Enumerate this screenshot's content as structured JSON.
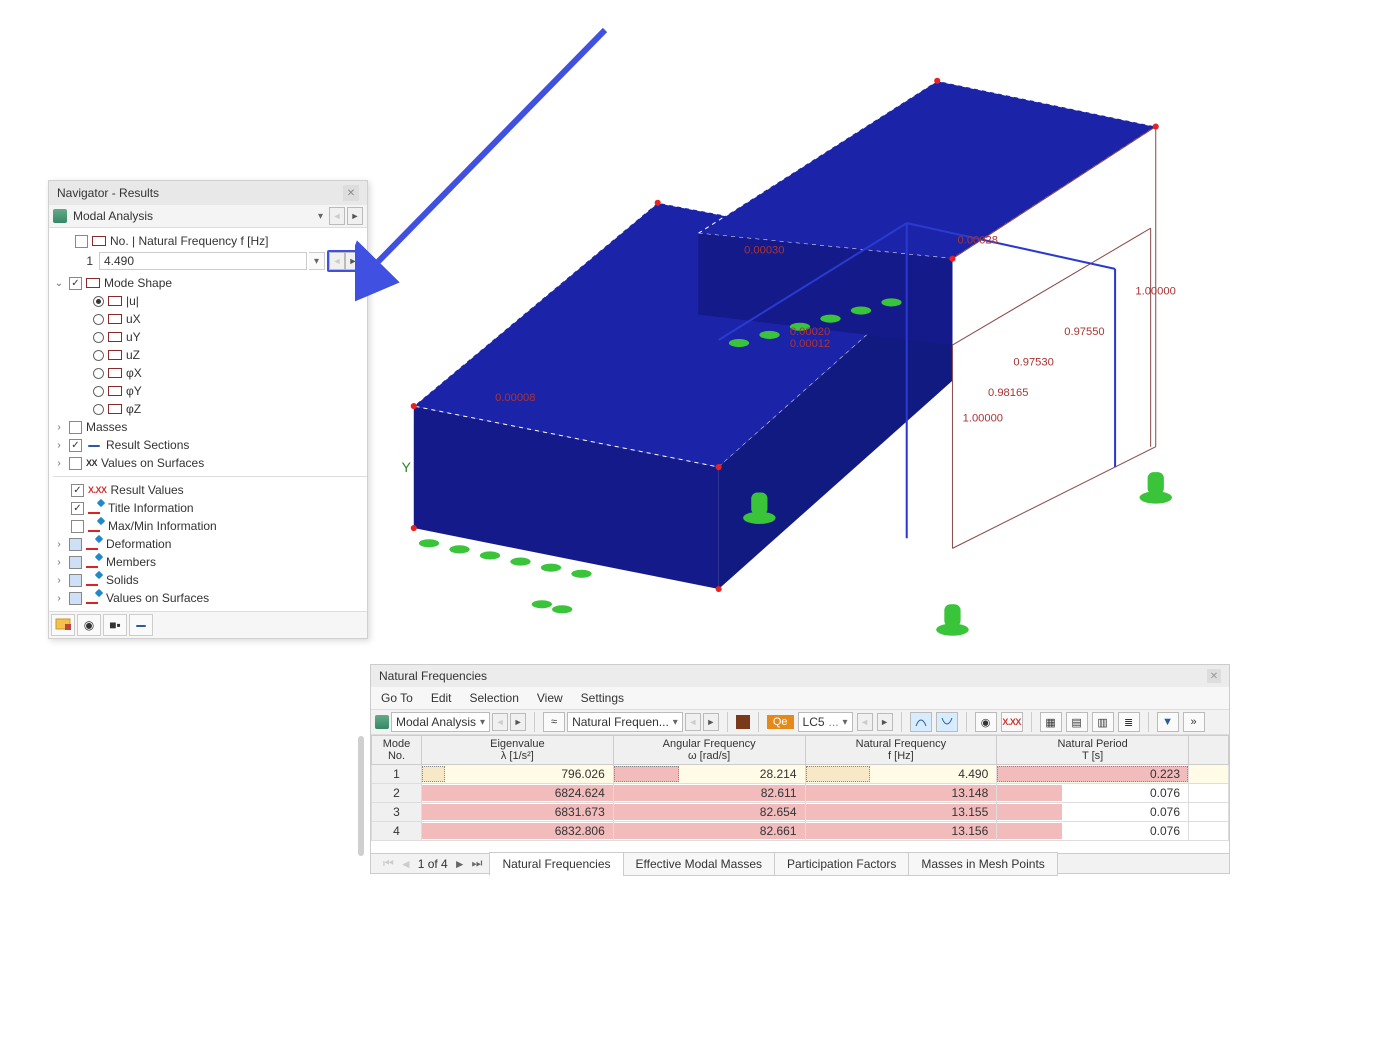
{
  "navigator": {
    "title": "Navigator - Results",
    "dropdown": "Modal Analysis",
    "mode_header": "No. | Natural Frequency f [Hz]",
    "mode_number": "1",
    "mode_value": "4.490",
    "mode_shape_label": "Mode Shape",
    "components": {
      "u": "|u|",
      "ux": "uX",
      "uy": "uY",
      "uz": "uZ",
      "px": "φX",
      "py": "φY",
      "pz": "φZ"
    },
    "masses": "Masses",
    "result_sections": "Result Sections",
    "values_on_surfaces_top": "Values on Surfaces",
    "result_values": "Result Values",
    "title_information": "Title Information",
    "maxmin_information": "Max/Min Information",
    "deformation": "Deformation",
    "members": "Members",
    "solids": "Solids",
    "values_on_surfaces_bottom": "Values on Surfaces"
  },
  "viewport": {
    "labels": {
      "top1": "0.00030",
      "top2": "0.00028",
      "leftmid": "0.00008",
      "mid1": "0.00020",
      "mid2": "0.00012",
      "right1": "1.00000",
      "right2": "0.97550",
      "right3": "0.97530",
      "right4": "0.98165",
      "right5": "1.00000",
      "axis_y": "Y"
    }
  },
  "results_panel": {
    "title": "Natural Frequencies",
    "menu": {
      "goto": "Go To",
      "edit": "Edit",
      "selection": "Selection",
      "view": "View",
      "settings": "Settings"
    },
    "toolbar": {
      "analysis_dd": "Modal Analysis",
      "result_dd": "Natural Frequen...",
      "qe": "Qe",
      "lc": "LC5",
      "lc_more": "..."
    },
    "columns": {
      "mode_no_l1": "Mode",
      "mode_no_l2": "No.",
      "eigen_l1": "Eigenvalue",
      "eigen_l2": "λ [1/s²]",
      "ang_l1": "Angular Frequency",
      "ang_l2": "ω [rad/s]",
      "nat_l1": "Natural Frequency",
      "nat_l2": "f [Hz]",
      "per_l1": "Natural Period",
      "per_l2": "T [s]"
    },
    "rows": [
      {
        "no": "1",
        "eigen": "796.026",
        "ang": "28.214",
        "nat": "4.490",
        "per": "0.223",
        "bars": {
          "eigen": 12,
          "ang": 34,
          "nat": 34,
          "per": 100
        },
        "sel": true
      },
      {
        "no": "2",
        "eigen": "6824.624",
        "ang": "82.611",
        "nat": "13.148",
        "per": "0.076",
        "bars": {
          "eigen": 100,
          "ang": 100,
          "nat": 100,
          "per": 34
        }
      },
      {
        "no": "3",
        "eigen": "6831.673",
        "ang": "82.654",
        "nat": "13.155",
        "per": "0.076",
        "bars": {
          "eigen": 100,
          "ang": 100,
          "nat": 100,
          "per": 34
        }
      },
      {
        "no": "4",
        "eigen": "6832.806",
        "ang": "82.661",
        "nat": "13.156",
        "per": "0.076",
        "bars": {
          "eigen": 100,
          "ang": 100,
          "nat": 100,
          "per": 34
        }
      }
    ],
    "pager_text": "1 of 4",
    "tabs": [
      "Natural Frequencies",
      "Effective Modal Masses",
      "Participation Factors",
      "Masses in Mesh Points"
    ]
  }
}
